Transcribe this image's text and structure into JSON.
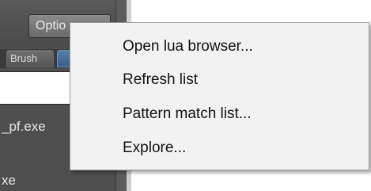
{
  "toolbar": {
    "options_label": "Optio"
  },
  "tabs": [
    {
      "label": "Brush"
    },
    {
      "label": ""
    }
  ],
  "list": {
    "items": [
      {
        "label": "_pf.exe"
      },
      {
        "label": "xe"
      }
    ]
  },
  "context_menu": {
    "items": [
      {
        "label": "Open lua browser..."
      },
      {
        "label": "Refresh list"
      },
      {
        "label": "Pattern match list..."
      },
      {
        "label": "Explore..."
      }
    ]
  },
  "colors": {
    "panel_bg": "#4e4e4e",
    "menu_bg": "#f2f2f2",
    "menu_text": "#111111"
  }
}
